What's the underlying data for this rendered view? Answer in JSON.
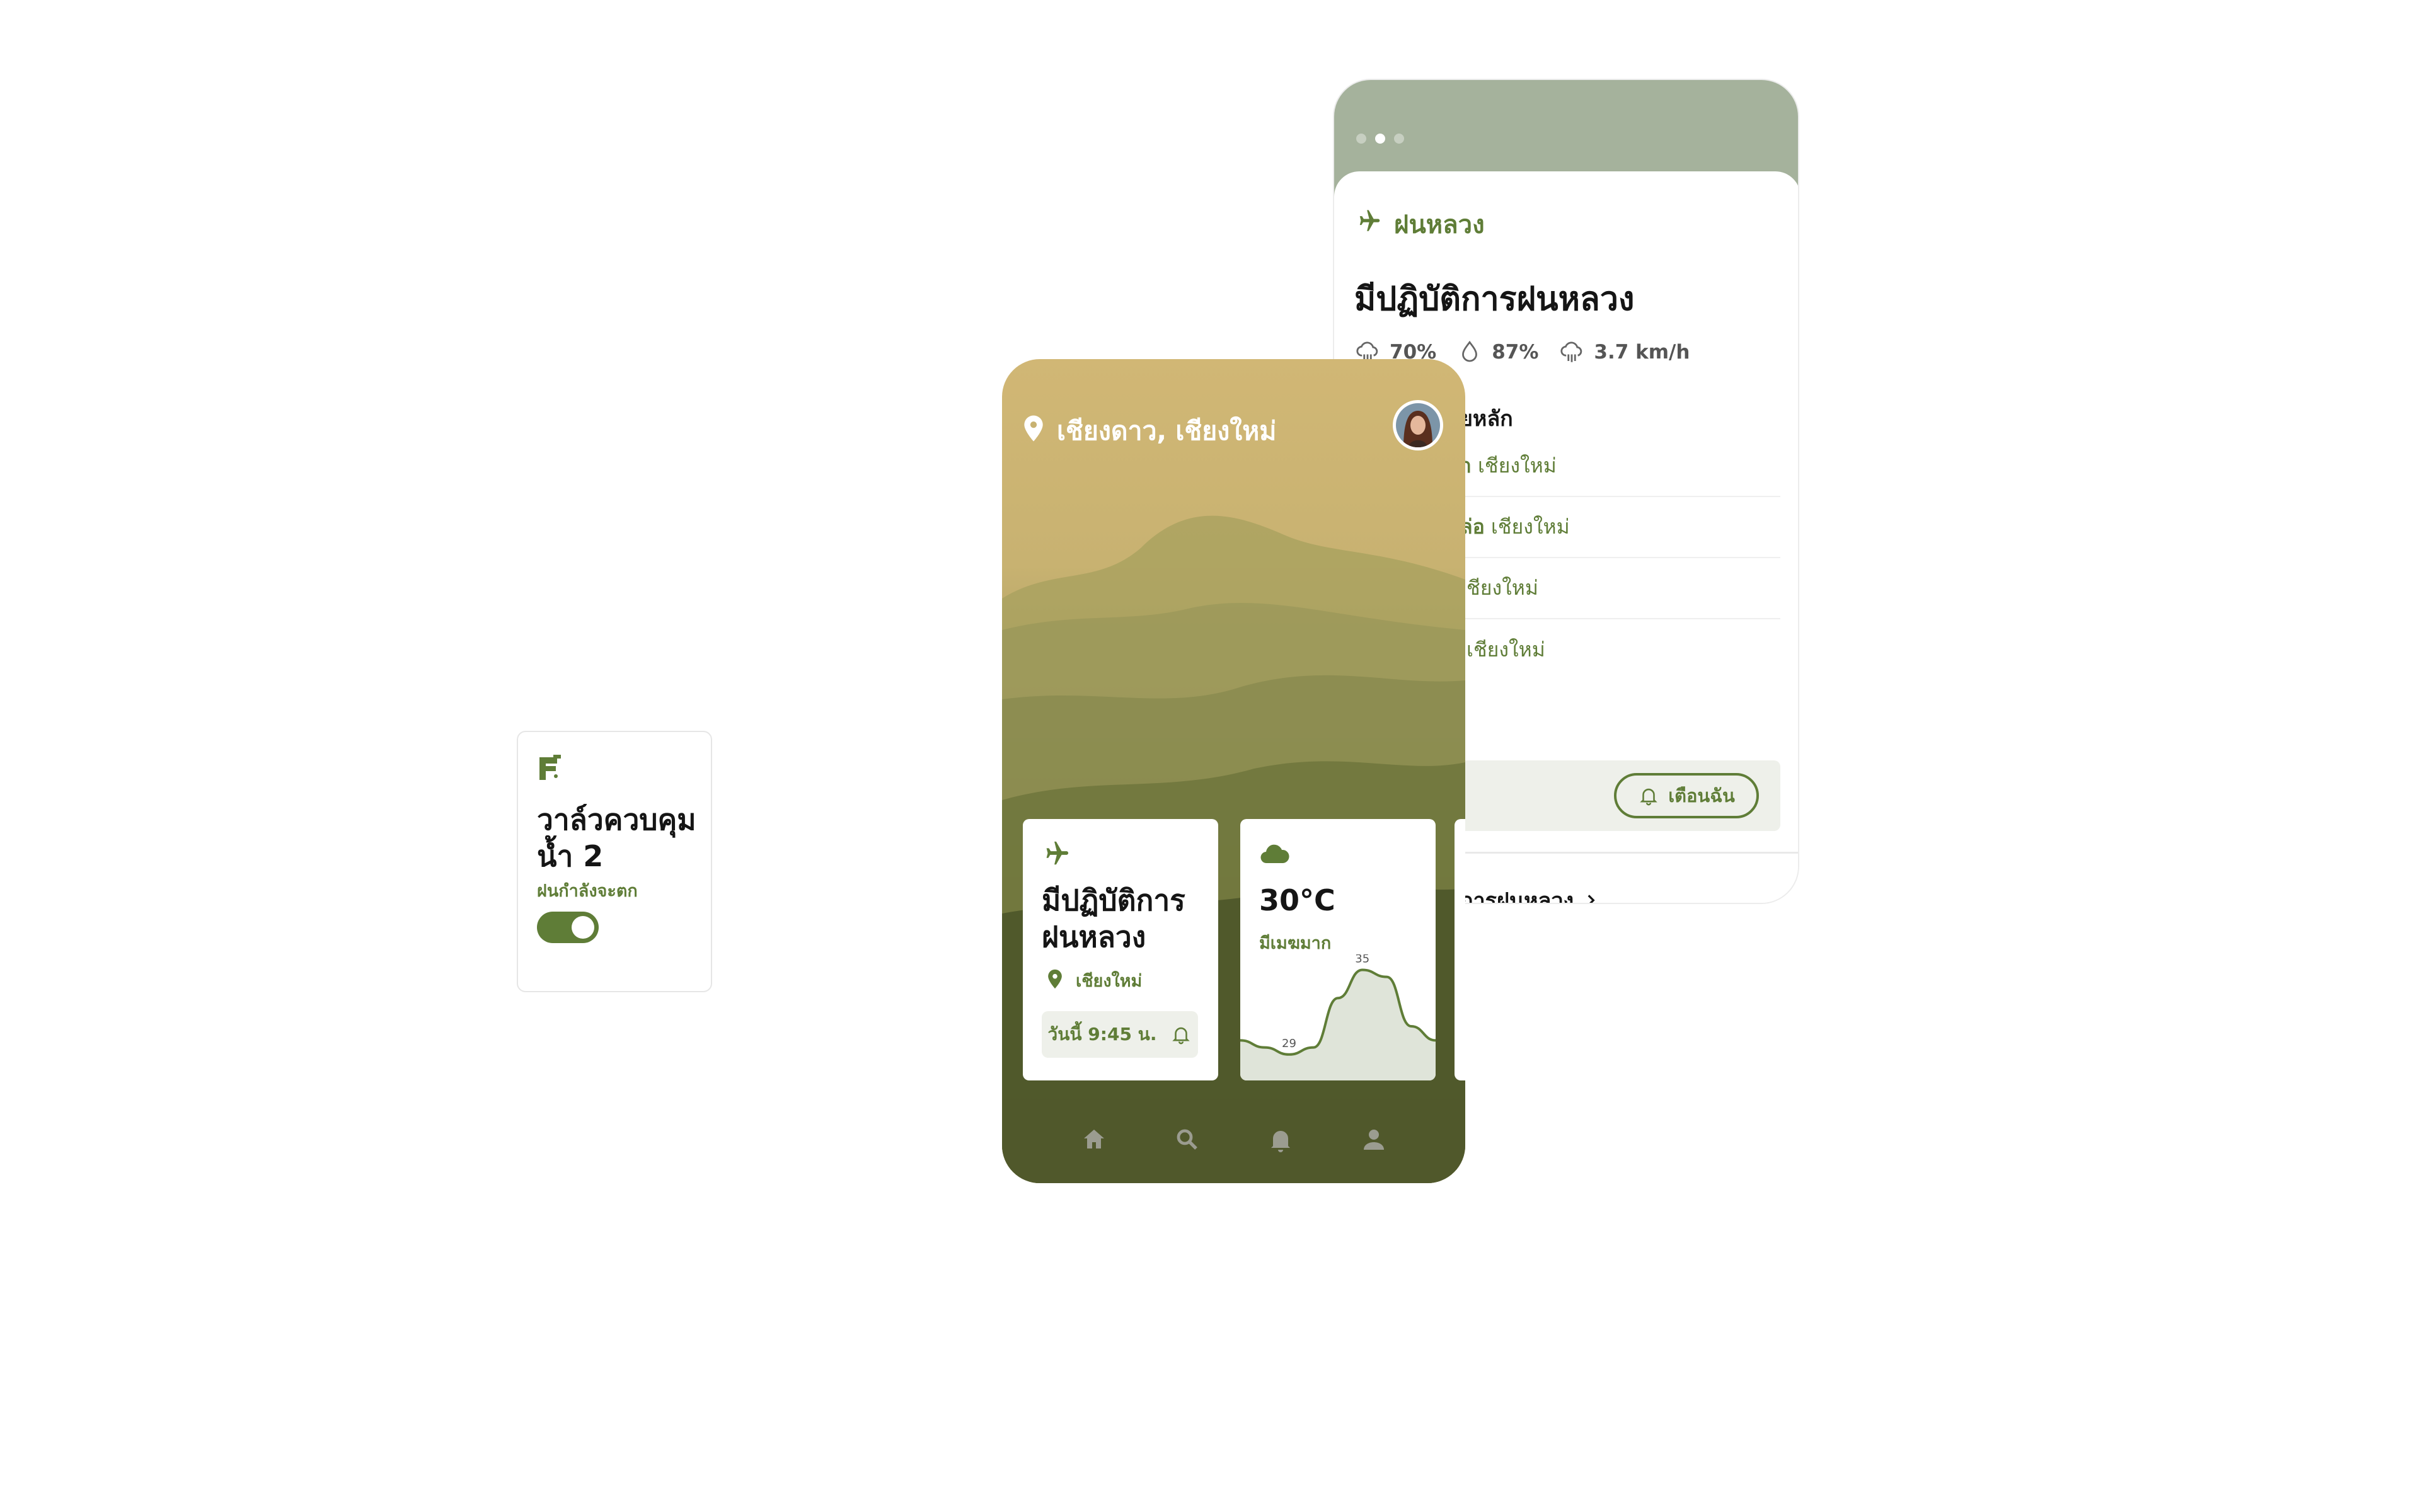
{
  "valve_widget": {
    "title": "วาล์วควบคุมน้ำ 2",
    "status": "ฝนกำลังจะตก",
    "toggle_on": true,
    "icon": "valve-icon"
  },
  "detail": {
    "tag": "ฝนหลวง",
    "title": "มีปฏิบัติการฝนหลวง",
    "stats": [
      {
        "icon": "rain-cloud-icon",
        "value": "70%"
      },
      {
        "icon": "water-drop-icon",
        "value": "87%"
      },
      {
        "icon": "rain-cloud-icon",
        "value": "3.7 km/h"
      }
    ],
    "section_title": "ยหลัก",
    "locations": [
      {
        "bold": "า",
        "rest": "เชียงใหม่"
      },
      {
        "bold": "ล่อ",
        "rest": "เชียงใหม่"
      },
      {
        "bold": "",
        "rest": "ชียงใหม่"
      },
      {
        "bold": "",
        "rest": "เชียงใหม่"
      }
    ],
    "remind_left_text": ".",
    "remind_button": "เตือนฉัน",
    "link": "ิการฝนหลวง",
    "pager_active": 1
  },
  "phone": {
    "location": "เชียงดาว, เชียงใหม่",
    "card_operation": {
      "title": "มีปฏิบัติการฝนหลวง",
      "location": "เชียงใหม่",
      "time": "วันนี้ 9:45 น."
    },
    "card_weather": {
      "temp": "30°C",
      "desc": "มีเมฆมาก",
      "min_label": "29",
      "max_label": "35"
    },
    "nav": [
      "home-icon",
      "search-icon",
      "bell-icon",
      "profile-icon"
    ]
  },
  "chart_data": {
    "type": "area",
    "series": [
      {
        "values": [
          30,
          29.5,
          29,
          29.5,
          33,
          35,
          34.5,
          31,
          30
        ]
      }
    ],
    "labels": [
      {
        "text": "29"
      },
      {
        "text": "35"
      }
    ]
  },
  "colors": {
    "accent": "#5f7d37",
    "sand": "#d1b775",
    "forest": "#252d14"
  }
}
